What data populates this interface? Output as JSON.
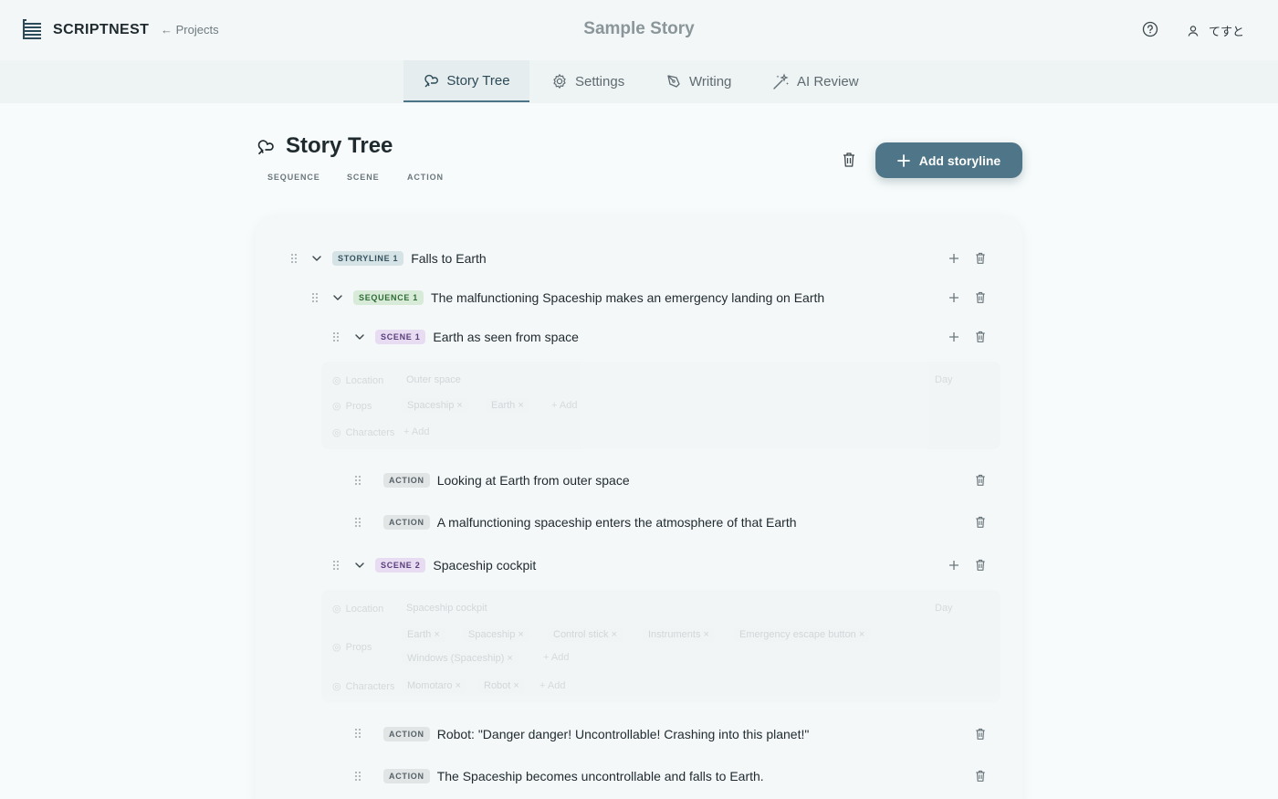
{
  "header": {
    "app_name": "SCRIPTNEST",
    "back_label": "← Projects",
    "story_title": "Sample Story",
    "user_name": "てすと"
  },
  "tabs": [
    {
      "label": "Story Tree",
      "icon": "tree-icon",
      "active": true
    },
    {
      "label": "Settings",
      "icon": "gear-icon",
      "active": false
    },
    {
      "label": "Writing",
      "icon": "pen-icon",
      "active": false
    },
    {
      "label": "AI Review",
      "icon": "sparkle-icon",
      "active": false
    }
  ],
  "page": {
    "title": "Story Tree",
    "legend": [
      "SEQUENCE",
      "SCENE",
      "ACTION"
    ],
    "add_button": "Add storyline"
  },
  "tree": {
    "storyline": {
      "badge": "STORYLINE 1",
      "text": "Falls to Earth"
    },
    "sequence": {
      "badge": "SEQUENCE 1",
      "text": "The malfunctioning Spaceship makes an emergency landing on Earth"
    },
    "scene1": {
      "badge": "SCENE 1",
      "text": "Earth as seen from space",
      "detail": {
        "location_label": "Location",
        "location_value": "Outer space",
        "time": "Day",
        "props_label": "Props",
        "props": [
          "Spaceship ×",
          "Earth ×"
        ],
        "props_add": "+ Add",
        "characters_label": "Characters",
        "characters_add": "+ Add"
      },
      "actions": [
        {
          "badge": "ACTION",
          "text": "Looking at Earth from outer space"
        },
        {
          "badge": "ACTION",
          "text": "A malfunctioning spaceship enters the atmosphere of that Earth"
        }
      ]
    },
    "scene2": {
      "badge": "SCENE 2",
      "text": "Spaceship cockpit",
      "detail": {
        "location_label": "Location",
        "location_value": "Spaceship cockpit",
        "time": "Day",
        "props_label": "Props",
        "props_row1": [
          "Earth ×",
          "Spaceship ×",
          "Control stick ×",
          "Instruments ×",
          "Emergency escape button ×"
        ],
        "props_row2": [
          "Windows (Spaceship) ×"
        ],
        "props_add": "+ Add",
        "characters_label": "Characters",
        "characters": [
          "Momotaro ×",
          "Robot ×"
        ],
        "characters_add": "+ Add"
      },
      "actions": [
        {
          "badge": "ACTION",
          "text": "Robot: \"Danger danger! Uncontrollable! Crashing into this planet!\""
        },
        {
          "badge": "ACTION",
          "text": "The Spaceship becomes uncontrollable and falls to Earth."
        }
      ]
    }
  },
  "colors": {
    "accent": "#4f7688",
    "storyline_badge": "#d5e2e6",
    "sequence_badge": "#d7ebd8",
    "scene_badge": "#e7dcf2",
    "action_badge": "#e2e5e6"
  }
}
